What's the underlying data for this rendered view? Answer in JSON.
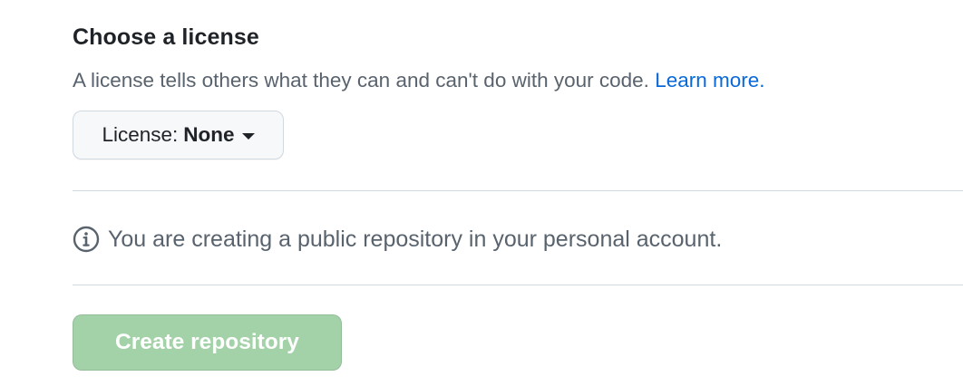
{
  "license_section": {
    "title": "Choose a license",
    "description": "A license tells others what they can and can't do with your code.",
    "learn_more_label": "Learn more.",
    "dropdown": {
      "prefix": "License:",
      "selected_value": "None",
      "icon": "caret-down-icon"
    }
  },
  "notice": {
    "icon": "info-icon",
    "text": "You are creating a public repository in your personal account."
  },
  "actions": {
    "create_label": "Create repository",
    "create_disabled": true
  },
  "colors": {
    "link": "#0969da",
    "muted_text": "#59636e",
    "primary_disabled": "#a3d2a8",
    "border": "#d1d9e0"
  }
}
